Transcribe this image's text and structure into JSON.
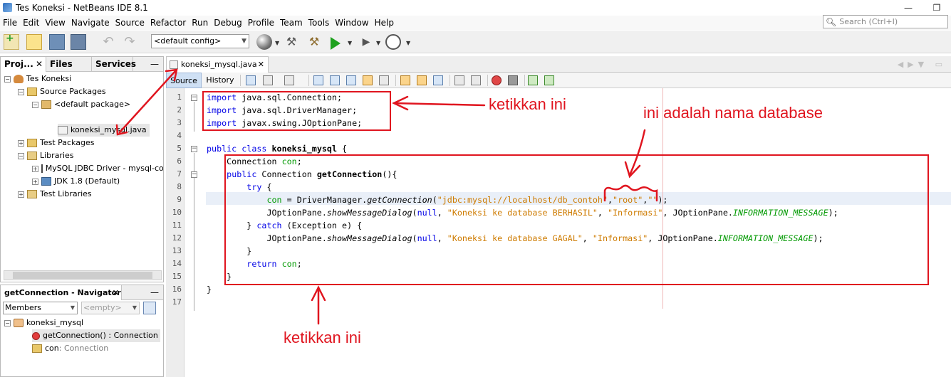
{
  "window": {
    "title": "Tes Koneksi - NetBeans IDE 8.1",
    "minimize": "—",
    "maximize": "❐"
  },
  "menu": [
    "File",
    "Edit",
    "View",
    "Navigate",
    "Source",
    "Refactor",
    "Run",
    "Debug",
    "Profile",
    "Team",
    "Tools",
    "Window",
    "Help"
  ],
  "search": {
    "placeholder": "Search (Ctrl+I)"
  },
  "toolbar": {
    "config": "<default config>"
  },
  "projects_panel": {
    "tabs": [
      "Proj...",
      "Files",
      "Services"
    ],
    "tree": [
      {
        "label": "Tes Koneksi",
        "icon": "project-icon"
      },
      {
        "label": "Source Packages",
        "icon": "source-packages-icon"
      },
      {
        "label": "<default package>",
        "icon": "package-icon"
      },
      {
        "label": "koneksi_mysql.java",
        "icon": "java-file-icon"
      },
      {
        "label": "Test Packages",
        "icon": "test-packages-icon"
      },
      {
        "label": "Libraries",
        "icon": "libraries-icon"
      },
      {
        "label": "MySQL JDBC Driver - mysql-co",
        "icon": "jar-icon"
      },
      {
        "label": "JDK 1.8 (Default)",
        "icon": "jdk-icon"
      },
      {
        "label": "Test Libraries",
        "icon": "test-libraries-icon"
      }
    ]
  },
  "navigator": {
    "title": "getConnection - Navigator",
    "filter": "Members",
    "empty": "<empty>",
    "items": [
      {
        "label": "koneksi_mysql"
      },
      {
        "label": "getConnection() : Connection"
      },
      {
        "label": "con",
        "type": " : Connection"
      }
    ]
  },
  "editor": {
    "tab": "koneksi_mysql.java",
    "source_tab": "Source",
    "history_tab": "History",
    "lines": [
      "1",
      "2",
      "3",
      "4",
      "5",
      "6",
      "7",
      "8",
      "9",
      "10",
      "11",
      "12",
      "13",
      "14",
      "15",
      "16",
      "17"
    ],
    "code": {
      "l1": [
        "import",
        " java.sql.Connection;"
      ],
      "l2": [
        "import",
        " java.sql.DriverManager;"
      ],
      "l3": [
        "import",
        " javax.swing.JOptionPane;"
      ],
      "l5": [
        "public",
        " ",
        "class",
        " ",
        "koneksi_mysql",
        " {"
      ],
      "l6": [
        "    Connection ",
        "con",
        ";"
      ],
      "l7": [
        "    ",
        "public",
        " Connection ",
        "getConnection",
        "(){"
      ],
      "l8": [
        "        ",
        "try",
        " {"
      ],
      "l9": [
        "            ",
        "con",
        " = DriverManager.",
        "getConnection",
        "(",
        "\"jdbc:mysql://localhost/db_contoh\"",
        ",",
        "\"root\"",
        ",",
        "\"\"",
        ");"
      ],
      "l10": [
        "            JOptionPane.",
        "showMessageDialog",
        "(",
        "null",
        ", ",
        "\"Koneksi ke database BERHASIL\"",
        ", ",
        "\"Informasi\"",
        ", JOptionPane.",
        "INFORMATION_MESSAGE",
        ");"
      ],
      "l11": [
        "        } ",
        "catch",
        " (Exception ",
        "e",
        ") {"
      ],
      "l12": [
        "            JOptionPane.",
        "showMessageDialog",
        "(",
        "null",
        ", ",
        "\"Koneksi ke database GAGAL\"",
        ", ",
        "\"Informasi\"",
        ", JOptionPane.",
        "INFORMATION_MESSAGE",
        ");"
      ],
      "l13": [
        "        }"
      ],
      "l14": [
        "        ",
        "return",
        " ",
        "con",
        ";"
      ],
      "l15": [
        "    }"
      ],
      "l16": [
        "}"
      ]
    }
  },
  "annotations": {
    "type_this_top": "ketikkan ini",
    "db_name_note": "ini adalah nama database",
    "type_this_bottom": "ketikkan ini"
  },
  "colors": {
    "annotation": "#e0151f",
    "keyword": "#0000e6",
    "string": "#ce7b00",
    "constant": "#009900"
  }
}
